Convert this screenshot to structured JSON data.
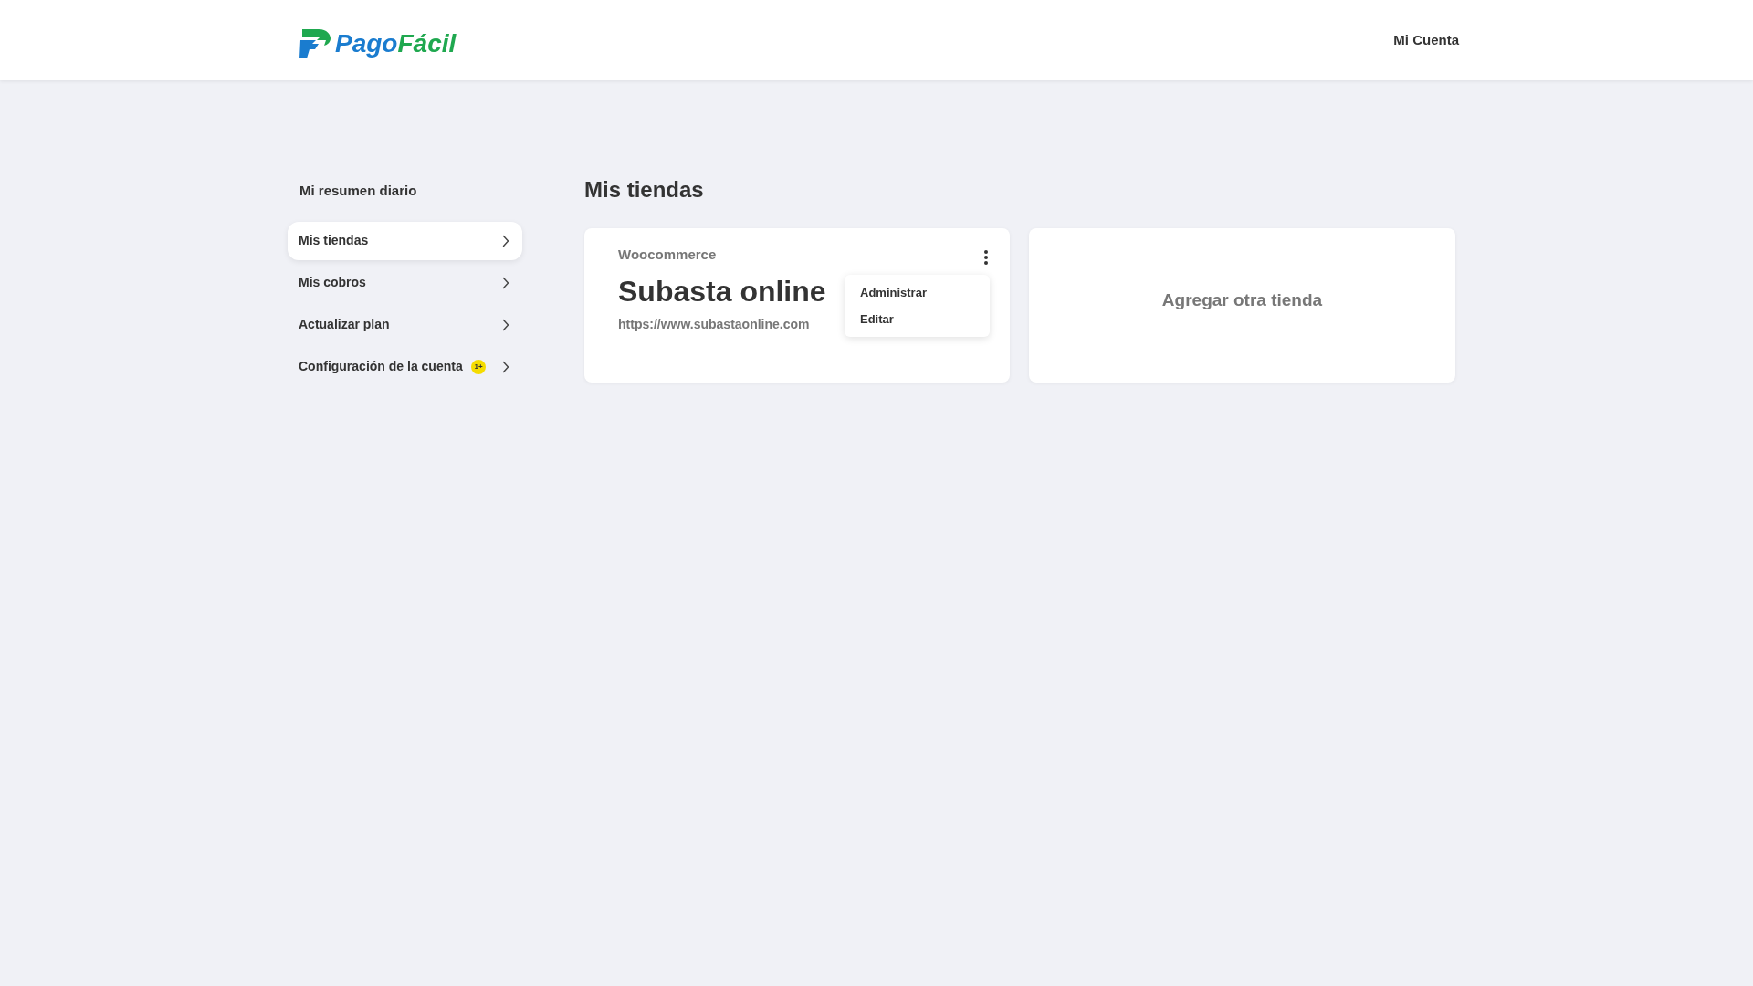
{
  "header": {
    "logo": {
      "parts": [
        "Pago",
        "Fácil"
      ]
    },
    "account_link": "Mi Cuenta"
  },
  "sidebar": {
    "heading": "Mi resumen diario",
    "items": [
      {
        "label": "Mis tiendas",
        "selected": true
      },
      {
        "label": "Mis cobros",
        "selected": false
      },
      {
        "label": "Actualizar plan",
        "selected": false
      },
      {
        "label": "Configuración de la cuenta",
        "selected": false,
        "badge": "1+"
      }
    ]
  },
  "main": {
    "title": "Mis tiendas",
    "stores": [
      {
        "platform": "Woocommerce",
        "name": "Subasta online",
        "url": "https://www.subastaonline.com",
        "menu_open": true,
        "menu_items": [
          "Administrar",
          "Editar"
        ]
      }
    ],
    "add_store": "Agregar otra tienda"
  }
}
